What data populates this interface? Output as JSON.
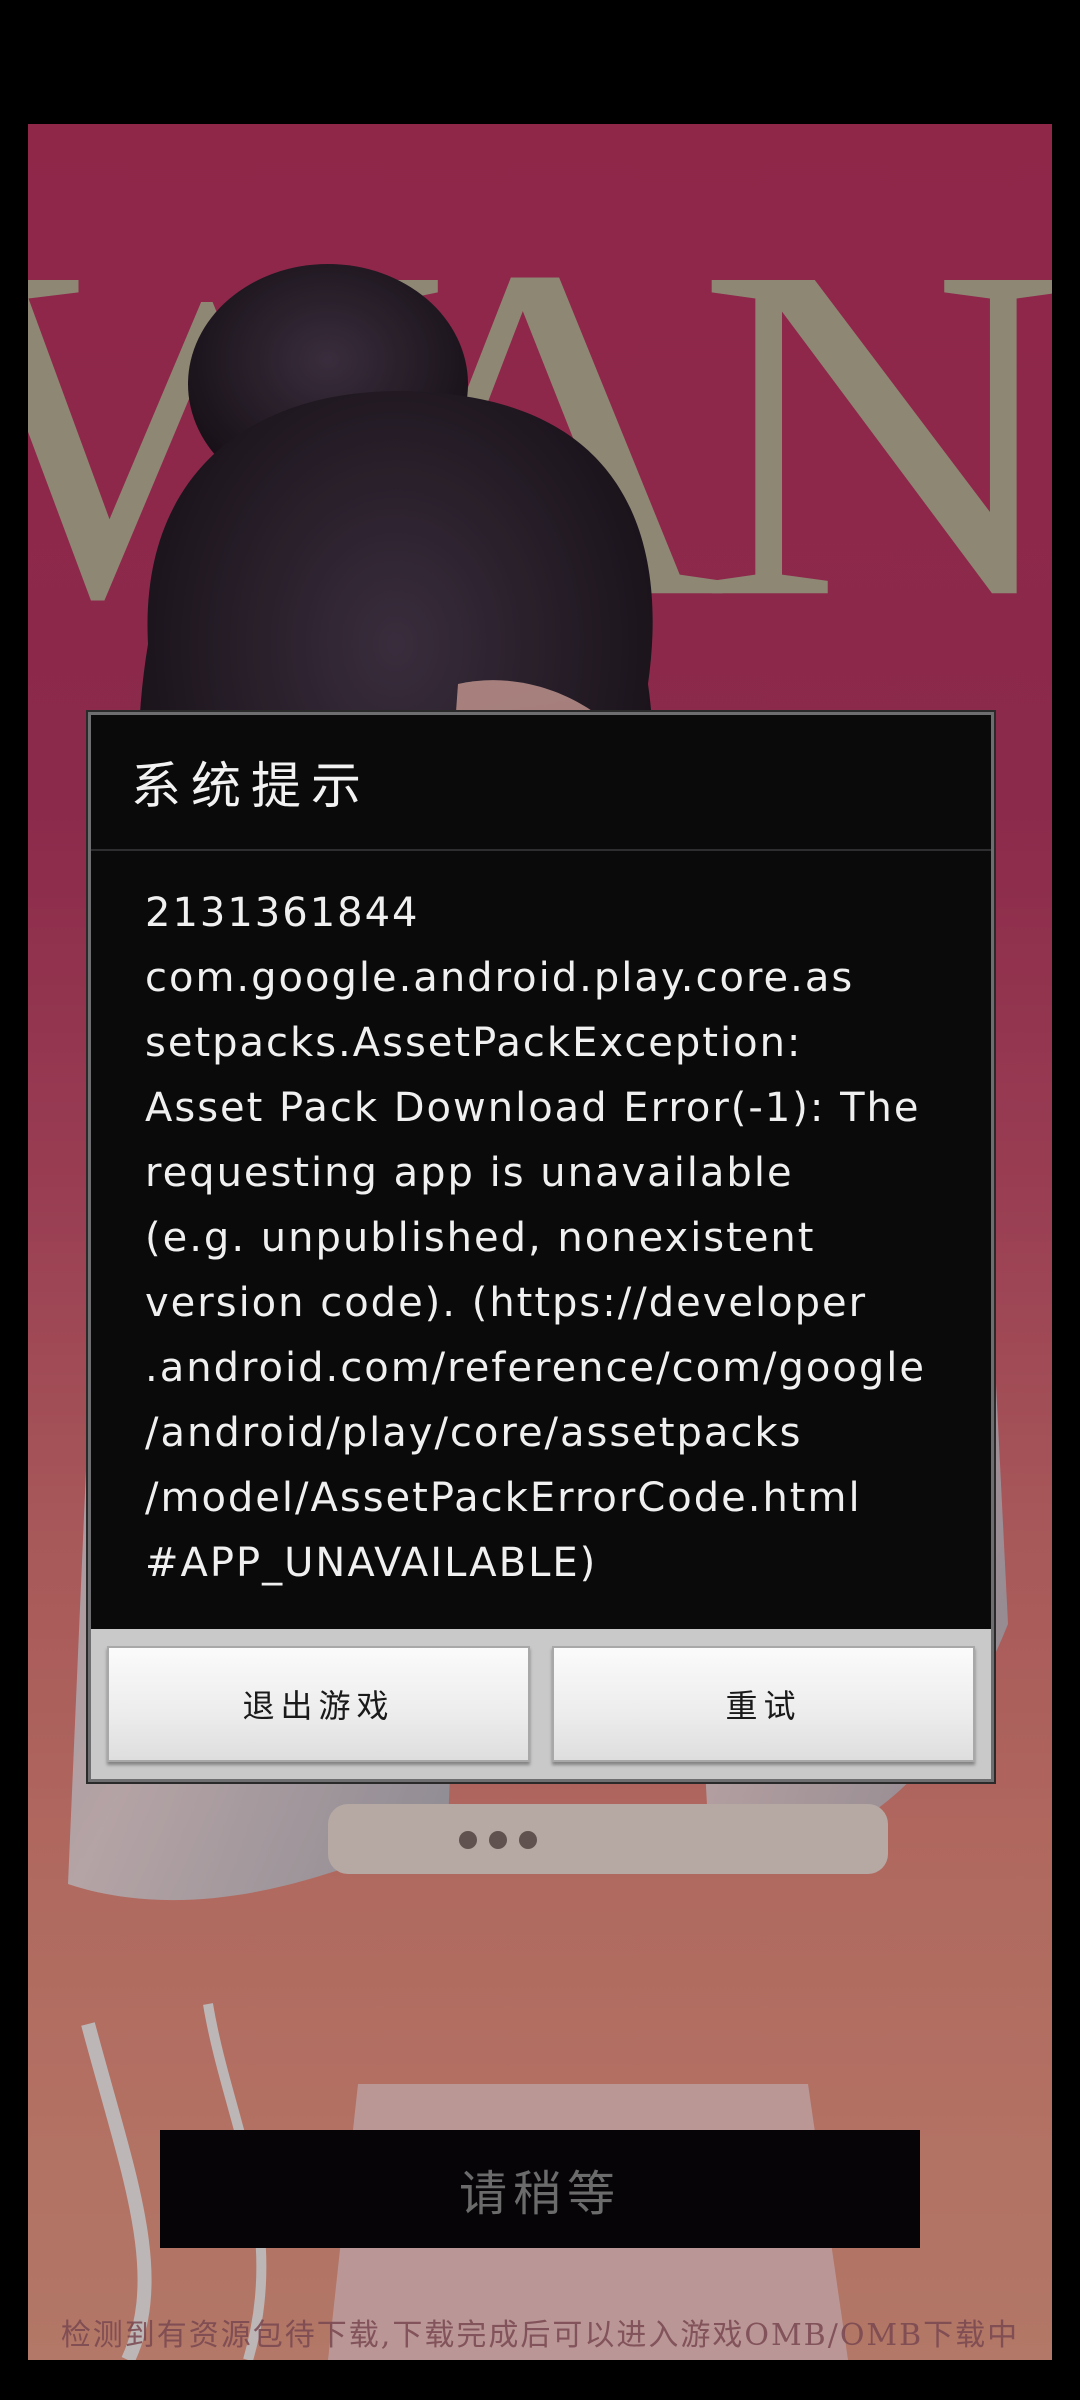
{
  "splash": {
    "background_logo": "WANNA"
  },
  "dialog": {
    "title": "系统提示",
    "message": "2131361844\ncom.google.android.play.core.as\nsetpacks.AssetPackException:\nAsset Pack Download Error(-1): The\nrequesting app is unavailable\n(e.g. unpublished, nonexistent\nversion code). (https://developer\n.android.com/reference/com/google\n/android/play/core/assetpacks\n/model/AssetPackErrorCode.html\n#APP_UNAVAILABLE)",
    "buttons": {
      "exit_label": "退出游戏",
      "retry_label": "重试"
    }
  },
  "footer": {
    "wait_label": "请稍等",
    "download_status": "检测到有资源包待下载,下载完成后可以进入游戏OMB/OMB下载中"
  },
  "colors": {
    "splash_pink": "#b8325e",
    "dialog_bg": "#0b0a0b",
    "button_bar_bg": "#c9c9c9"
  }
}
